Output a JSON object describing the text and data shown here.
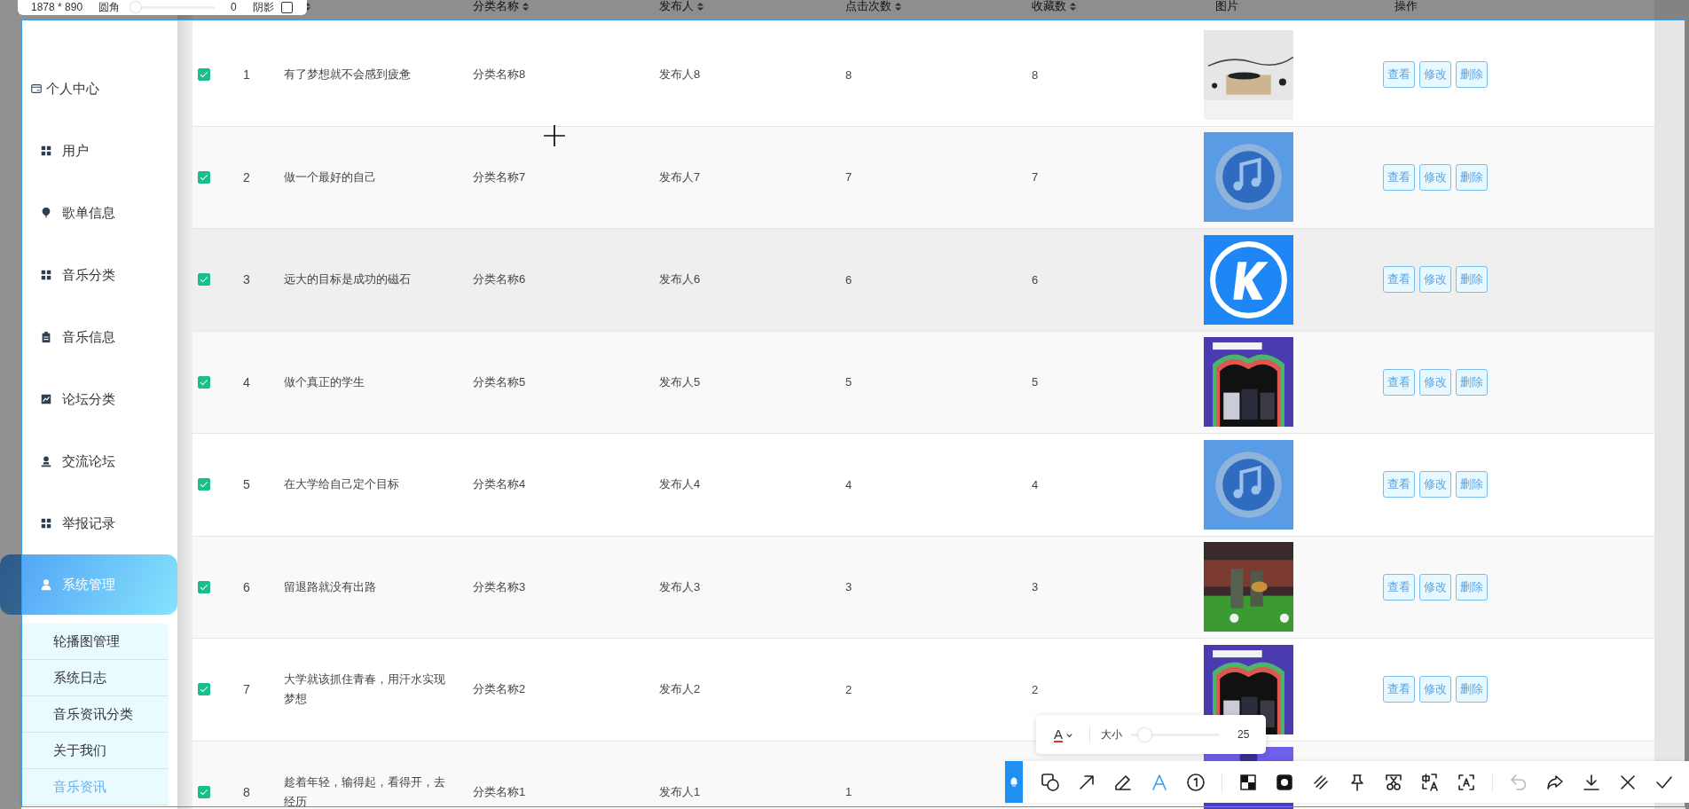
{
  "capture_panel": {
    "size": "1878 * 890",
    "corner_label": "圆角",
    "corner": {
      "level": 0
    },
    "corner_value": "0",
    "shadow_label": "阴影",
    "shadow": {
      "checked": false
    }
  },
  "sidebar": {
    "items": [
      {
        "label": "个人中心",
        "kind": "profile",
        "selected": false
      },
      {
        "label": "用户",
        "kind": "menu",
        "selected": false
      },
      {
        "label": "歌单信息",
        "kind": "menu",
        "selected": false
      },
      {
        "label": "音乐分类",
        "kind": "menu",
        "selected": false
      },
      {
        "label": "音乐信息",
        "kind": "menu",
        "selected": false
      },
      {
        "label": "论坛分类",
        "kind": "menu",
        "selected": false
      },
      {
        "label": "交流论坛",
        "kind": "menu",
        "selected": false
      },
      {
        "label": "举报记录",
        "kind": "menu",
        "selected": false
      },
      {
        "label": "系统管理",
        "kind": "menu",
        "selected": true,
        "expanded": true,
        "children": [
          {
            "label": "轮播图管理",
            "selected": false
          },
          {
            "label": "系统日志",
            "selected": false
          },
          {
            "label": "音乐资讯分类",
            "selected": false
          },
          {
            "label": "关于我们",
            "selected": false
          },
          {
            "label": "音乐资讯",
            "selected": true
          }
        ]
      }
    ]
  },
  "table": {
    "title_column": {
      "sortable": true
    },
    "columns": [
      {
        "label": "分类名称",
        "sortable": true
      },
      {
        "label": "发布人",
        "sortable": true
      },
      {
        "label": "点击次数",
        "sortable": true
      },
      {
        "label": "收藏数",
        "sortable": true
      },
      {
        "label": "图片",
        "sortable": false
      },
      {
        "label": "操作",
        "sortable": false
      }
    ],
    "rows": [
      {
        "checked": true,
        "highlighted": false,
        "index": "1",
        "title": "有了梦想就不会感到疲惫",
        "category": "分类名称8",
        "publisher": "发布人8",
        "clicks": "8",
        "favorites": "8",
        "actions": [
          "查看",
          "修改",
          "删除"
        ]
      },
      {
        "checked": true,
        "highlighted": false,
        "index": "2",
        "title": "做一个最好的自己",
        "category": "分类名称7",
        "publisher": "发布人7",
        "clicks": "7",
        "favorites": "7",
        "actions": [
          "查看",
          "修改",
          "删除"
        ]
      },
      {
        "checked": true,
        "highlighted": true,
        "index": "3",
        "title": "远大的目标是成功的磁石",
        "category": "分类名称6",
        "publisher": "发布人6",
        "clicks": "6",
        "favorites": "6",
        "actions": [
          "查看",
          "修改",
          "删除"
        ]
      },
      {
        "checked": true,
        "highlighted": false,
        "index": "4",
        "title": "做个真正的学生",
        "category": "分类名称5",
        "publisher": "发布人5",
        "clicks": "5",
        "favorites": "5",
        "actions": [
          "查看",
          "修改",
          "删除"
        ]
      },
      {
        "checked": true,
        "highlighted": false,
        "index": "5",
        "title": "在大学给自己定个目标",
        "category": "分类名称4",
        "publisher": "发布人4",
        "clicks": "4",
        "favorites": "4",
        "actions": [
          "查看",
          "修改",
          "删除"
        ]
      },
      {
        "checked": true,
        "highlighted": false,
        "index": "6",
        "title": "留退路就没有出路",
        "category": "分类名称3",
        "publisher": "发布人3",
        "clicks": "3",
        "favorites": "3",
        "actions": [
          "查看",
          "修改",
          "删除"
        ]
      },
      {
        "checked": true,
        "highlighted": false,
        "index": "7",
        "title": "大学就该抓住青春，用汗水实现梦想",
        "category": "分类名称2",
        "publisher": "发布人2",
        "clicks": "2",
        "favorites": "2",
        "actions": [
          "查看",
          "修改",
          "删除"
        ]
      },
      {
        "checked": true,
        "highlighted": false,
        "index": "8",
        "title": "趁着年轻，输得起，看得开，去经历",
        "category": "分类名称1",
        "publisher": "发布人1",
        "clicks": "1",
        "actions": []
      }
    ]
  },
  "text_options": {
    "glyph": "A",
    "color": "#e0302e",
    "size_label": "大小",
    "size": {
      "level": 0.08
    },
    "size_value": "25"
  },
  "tools": [
    {
      "selected": false,
      "disabled": false
    },
    {
      "selected": false,
      "disabled": false
    },
    {
      "selected": false,
      "disabled": false
    },
    {
      "selected": true,
      "disabled": false
    },
    {
      "selected": false,
      "disabled": false
    },
    {
      "selected": false,
      "disabled": false
    },
    {
      "selected": false,
      "disabled": false
    },
    {
      "selected": false,
      "disabled": false
    },
    {
      "selected": false,
      "disabled": false
    },
    {
      "selected": false,
      "disabled": false
    },
    {
      "selected": false,
      "disabled": false
    },
    {
      "selected": false,
      "disabled": false
    },
    {
      "selected": false,
      "disabled": true
    },
    {
      "selected": false,
      "disabled": false
    },
    {
      "selected": false,
      "disabled": false
    },
    {
      "selected": false,
      "disabled": false
    },
    {
      "selected": false,
      "disabled": false
    }
  ]
}
